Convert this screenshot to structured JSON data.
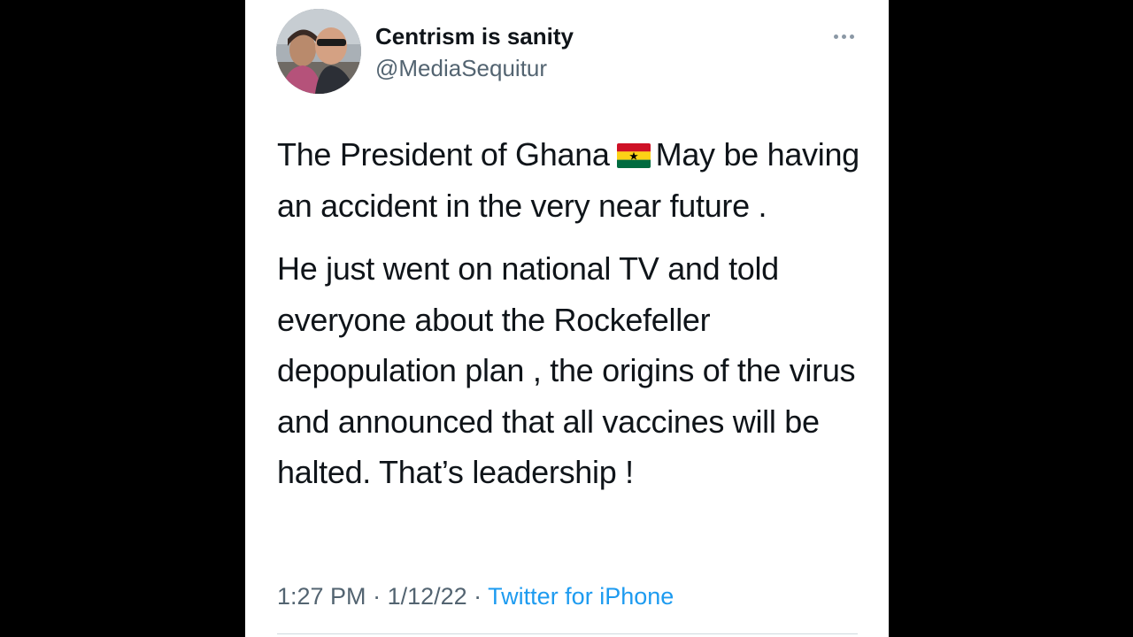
{
  "tweet": {
    "author": {
      "display_name": "Centrism is sanity",
      "handle": "@MediaSequitur"
    },
    "text": {
      "paragraph1_before_flag": "The President of Ghana",
      "flag_icon": "ghana-flag-emoji",
      "paragraph1_after_flag": "May be having an accident in the very near future .",
      "paragraph2": "He just went on national TV and told everyone about the Rockefeller depopulation plan , the origins of the virus and announced that all vaccines will be halted. That’s leadership !"
    },
    "meta": {
      "time": "1:27 PM",
      "separator1": " · ",
      "date": "1/12/22",
      "separator2": " · ",
      "source": "Twitter for iPhone"
    },
    "more_icon": "more-options-icon"
  },
  "colors": {
    "background": "#000000",
    "card": "#ffffff",
    "text_primary": "#0f1419",
    "text_secondary": "#536471",
    "link": "#1d9bf0",
    "flag_red": "#ce1126",
    "flag_gold": "#fcd116",
    "flag_green": "#006b3f"
  }
}
